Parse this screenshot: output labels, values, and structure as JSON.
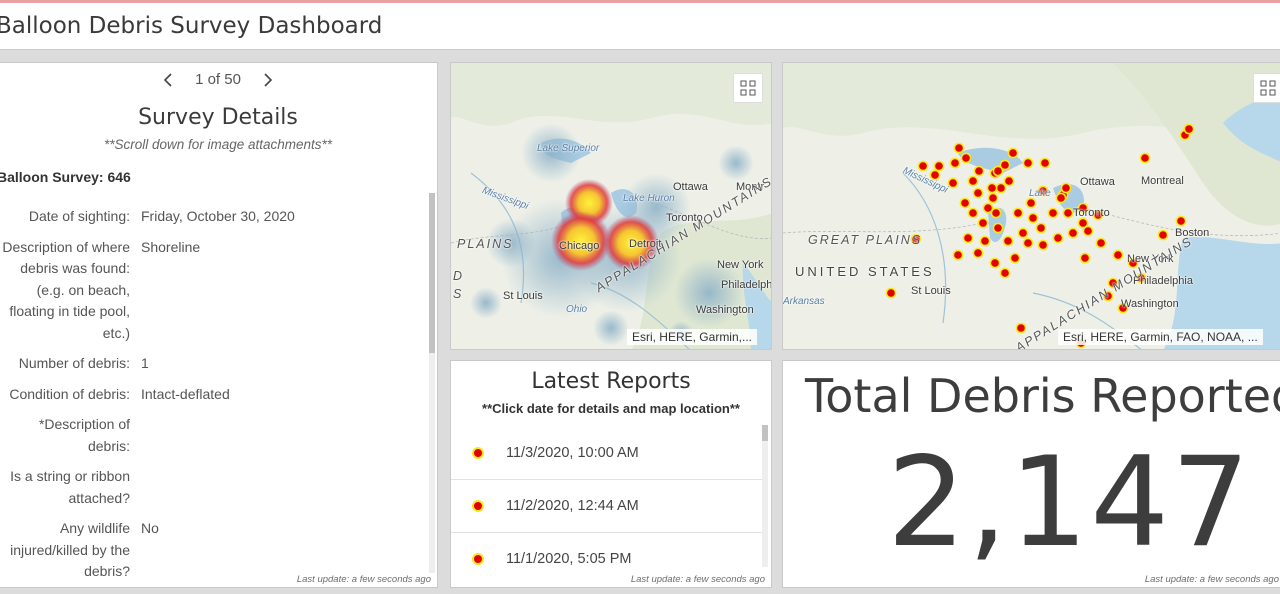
{
  "header": {
    "title": "Balloon Debris Survey Dashboard"
  },
  "details": {
    "pager": {
      "current": "1 of 50"
    },
    "title": "Survey Details",
    "subtitle": "**Scroll down for image attachments**",
    "record_heading": "Balloon Survey: 646",
    "fields": [
      {
        "label": "Date of sighting:",
        "value": "Friday, October 30, 2020"
      },
      {
        "label": "Description of where debris was found: (e.g. on beach, floating in tide pool, etc.)",
        "value": "Shoreline"
      },
      {
        "label": "Number of debris:",
        "value": "1"
      },
      {
        "label": "Condition of debris:",
        "value": "Intact-deflated"
      },
      {
        "label": "*Description of debris:",
        "value": ""
      },
      {
        "label": "Is a string or ribbon attached?",
        "value": ""
      },
      {
        "label": "Any wildlife injured/killed by the debris?",
        "value": "No"
      }
    ],
    "last_update": "Last update: a few seconds ago"
  },
  "heatmap": {
    "labels": {
      "lake_superior": "Lake Superior",
      "mississippi": "Mississippi",
      "ottawa": "Ottawa",
      "montreal": "Montr",
      "lake_huron": "Lake Huron",
      "toronto": "Toronto",
      "chicago": "Chicago",
      "detroit": "Detroit",
      "plains": "PLAINS",
      "new_york": "New York",
      "philadelphia": "Philadelph",
      "st_louis": "St Louis",
      "ohio": "Ohio",
      "washington": "Washington",
      "appalachian": "APPALACHIAN MOUNTAINS",
      "s_fragment": "S",
      "d_fragment": "D"
    },
    "attribution": "Esri, HERE, Garmin,..."
  },
  "pointmap": {
    "labels": {
      "ottawa": "Ottawa",
      "montreal": "Montreal",
      "lake": "Lake",
      "toronto": "Toronto",
      "boston": "Boston",
      "great_plains": "GREAT PLAINS",
      "united_states": "UNITED STATES",
      "new_york": "New York",
      "philadelphia": "Philadelphia",
      "washington": "Washington",
      "st_louis": "St Louis",
      "arkansas": "Arkansas",
      "mississippi": "Mississippi",
      "appalachian": "APPALACHIAN MOUNTAINS"
    },
    "attribution": "Esri, HERE, Garmin, FAO, NOAA, ..."
  },
  "reports": {
    "title": "Latest Reports",
    "subtitle": "**Click date for details and map location**",
    "items": [
      {
        "date": "11/3/2020, 10:00 AM"
      },
      {
        "date": "11/2/2020, 12:44 AM"
      },
      {
        "date": "11/1/2020, 5:05 PM"
      }
    ],
    "last_update": "Last update: a few seconds ago"
  },
  "total": {
    "title": "Total Debris Reported",
    "value": "2,147",
    "last_update": "Last update: a few seconds ago"
  },
  "colors": {
    "point_fill": "#e30000",
    "point_stroke": "#f7e81c",
    "heat_core": "#fff23a",
    "heat_mid": "#e23a3a",
    "heat_outer": "#8fb3c9"
  }
}
